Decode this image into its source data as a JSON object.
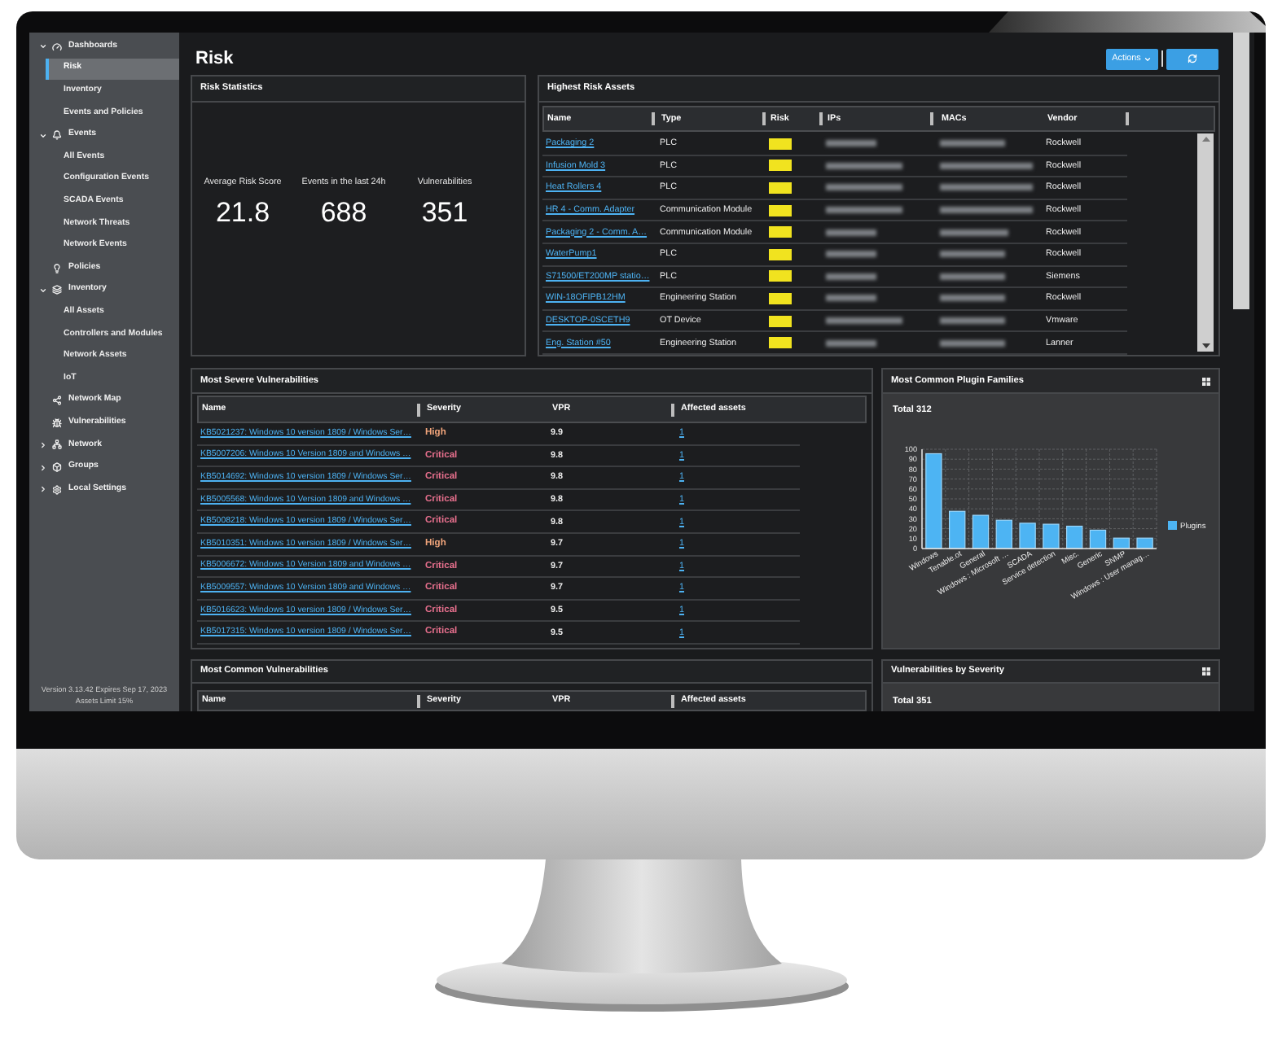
{
  "sidebar": {
    "items": [
      {
        "label": "Dashboards",
        "expanded": true,
        "children": [
          {
            "label": "Risk",
            "selected": true
          },
          {
            "label": "Inventory",
            "selected": false
          },
          {
            "label": "Events and Policies",
            "selected": false
          }
        ]
      },
      {
        "label": "Events",
        "expanded": true,
        "children": [
          {
            "label": "All Events",
            "selected": false
          },
          {
            "label": "Configuration Events",
            "selected": false
          },
          {
            "label": "SCADA Events",
            "selected": false
          },
          {
            "label": "Network Threats",
            "selected": false
          },
          {
            "label": "Network Events",
            "selected": false
          }
        ]
      },
      {
        "label": "Policies"
      },
      {
        "label": "Inventory",
        "expanded": true,
        "children": [
          {
            "label": "All Assets",
            "selected": false
          },
          {
            "label": "Controllers and Modules",
            "selected": false
          },
          {
            "label": "Network Assets",
            "selected": false
          },
          {
            "label": "IoT",
            "selected": false
          }
        ]
      },
      {
        "label": "Network Map"
      },
      {
        "label": "Vulnerabilities"
      },
      {
        "label": "Network",
        "expanded": false
      },
      {
        "label": "Groups",
        "expanded": false
      },
      {
        "label": "Local Settings",
        "expanded": false
      }
    ],
    "footer": [
      "Version 3.13.42 Expires Sep 17, 2023",
      "Assets Limit 15%"
    ]
  },
  "header": {
    "title": "Risk",
    "actions": "Actions"
  },
  "risk_statistics": {
    "title": "Risk Statistics",
    "stats": [
      {
        "label": "Average Risk Score",
        "value": "21.8"
      },
      {
        "label": "Events in the last 24h",
        "value": "688"
      },
      {
        "label": "Vulnerabilities",
        "value": "351"
      }
    ]
  },
  "highest_risk_assets": {
    "title": "Highest Risk Assets",
    "columns": [
      "Name",
      "Type",
      "Risk",
      "IPs",
      "MACs",
      "Vendor"
    ],
    "rows": [
      {
        "name": "Packaging 2",
        "type": "PLC",
        "vendor": "Rockwell"
      },
      {
        "name": "Infusion Mold 3",
        "type": "PLC",
        "vendor": "Rockwell"
      },
      {
        "name": "Heat Rollers 4",
        "type": "PLC",
        "vendor": "Rockwell"
      },
      {
        "name": "HR 4 - Comm. Adapter",
        "type": "Communication Module",
        "vendor": "Rockwell"
      },
      {
        "name": "Packaging 2 - Comm. A…",
        "type": "Communication Module",
        "vendor": "Rockwell"
      },
      {
        "name": "WaterPump1",
        "type": "PLC",
        "vendor": "Rockwell"
      },
      {
        "name": "S71500/ET200MP statio…",
        "type": "PLC",
        "vendor": "Siemens"
      },
      {
        "name": "WIN-18OFIPB12HM",
        "type": "Engineering Station",
        "vendor": "Rockwell"
      },
      {
        "name": "DESKTOP-0SCETH9",
        "type": "OT Device",
        "vendor": "Vmware"
      },
      {
        "name": "Eng. Station #50",
        "type": "Engineering Station",
        "vendor": "Lanner"
      }
    ]
  },
  "most_severe_vulnerabilities": {
    "title": "Most Severe Vulnerabilities",
    "columns": [
      "Name",
      "Severity",
      "VPR",
      "Affected assets"
    ],
    "rows": [
      {
        "name": "KB5021237: Windows 10 version 1809 / Windows Ser…",
        "severity": "High",
        "color": "#f3a67c",
        "vpr": "9.9",
        "affected_assets": "1"
      },
      {
        "name": "KB5007206: Windows 10 Version 1809 and Windows …",
        "severity": "Critical",
        "color": "#e8708e",
        "vpr": "9.8",
        "affected_assets": "1"
      },
      {
        "name": "KB5014692: Windows 10 version 1809 / Windows Ser…",
        "severity": "Critical",
        "color": "#e8708e",
        "vpr": "9.8",
        "affected_assets": "1"
      },
      {
        "name": "KB5005568: Windows 10 Version 1809 and Windows …",
        "severity": "Critical",
        "color": "#e8708e",
        "vpr": "9.8",
        "affected_assets": "1"
      },
      {
        "name": "KB5008218: Windows 10 version 1809 / Windows Ser…",
        "severity": "Critical",
        "color": "#e8708e",
        "vpr": "9.8",
        "affected_assets": "1"
      },
      {
        "name": "KB5010351: Windows 10 version 1809 / Windows Ser…",
        "severity": "High",
        "color": "#f3a67c",
        "vpr": "9.7",
        "affected_assets": "1"
      },
      {
        "name": "KB5006672: Windows 10 Version 1809 and Windows …",
        "severity": "Critical",
        "color": "#e8708e",
        "vpr": "9.7",
        "affected_assets": "1"
      },
      {
        "name": "KB5009557: Windows 10 Version 1809 and Windows …",
        "severity": "Critical",
        "color": "#e8708e",
        "vpr": "9.7",
        "affected_assets": "1"
      },
      {
        "name": "KB5016623: Windows 10 version 1809 / Windows Ser…",
        "severity": "Critical",
        "color": "#e8708e",
        "vpr": "9.5",
        "affected_assets": "1"
      },
      {
        "name": "KB5017315: Windows 10 version 1809 / Windows Ser…",
        "severity": "Critical",
        "color": "#e8708e",
        "vpr": "9.5",
        "affected_assets": "1"
      }
    ]
  },
  "plugin_families": {
    "title": "Most Common Plugin Families",
    "total": "Total 312",
    "chart_data": {
      "type": "bar",
      "categories": [
        "Windows",
        "Tenable.ot",
        "General",
        "Windows : Microsoft …",
        "SCADA",
        "Service detection",
        "Misc.",
        "Generic",
        "SNMP",
        "Windows : User manag…"
      ],
      "series": [
        {
          "name": "Plugins",
          "color": "#4db4f3",
          "values": [
            96,
            38,
            34,
            29,
            26,
            25,
            23,
            19,
            11,
            11
          ]
        }
      ],
      "ylim": [
        0,
        100
      ],
      "yticks": [
        0,
        10,
        20,
        30,
        40,
        50,
        60,
        70,
        80,
        90,
        100
      ],
      "grid": true
    }
  },
  "most_common_vulnerabilities": {
    "title": "Most Common Vulnerabilities",
    "columns": [
      "Name",
      "Severity",
      "VPR",
      "Affected assets"
    ]
  },
  "vulnerabilities_by_severity": {
    "title": "Vulnerabilities by Severity",
    "total": "Total 351"
  }
}
